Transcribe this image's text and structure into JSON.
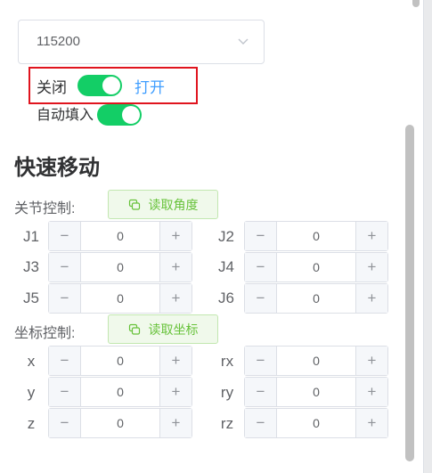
{
  "baud_select": {
    "value": "115200"
  },
  "connection": {
    "close_label": "关闭",
    "open_label": "打开",
    "switch_on": true
  },
  "autofill": {
    "label": "自动填入",
    "switch_on": true
  },
  "quick_move": {
    "title": "快速移动",
    "joint_group": {
      "label": "关节控制:",
      "read_button": "读取角度",
      "fields": [
        {
          "name": "J1",
          "value": "0"
        },
        {
          "name": "J2",
          "value": "0"
        },
        {
          "name": "J3",
          "value": "0"
        },
        {
          "name": "J4",
          "value": "0"
        },
        {
          "name": "J5",
          "value": "0"
        },
        {
          "name": "J6",
          "value": "0"
        }
      ]
    },
    "coord_group": {
      "label": "坐标控制:",
      "read_button": "读取坐标",
      "fields": [
        {
          "name": "x",
          "value": "0"
        },
        {
          "name": "rx",
          "value": "0"
        },
        {
          "name": "y",
          "value": "0"
        },
        {
          "name": "ry",
          "value": "0"
        },
        {
          "name": "z",
          "value": "0"
        },
        {
          "name": "rz",
          "value": "0"
        }
      ]
    },
    "minus_symbol": "−",
    "plus_symbol": "+"
  },
  "colors": {
    "switch_on": "#13ce66",
    "open_link": "#409eff",
    "read_button_text": "#67c23a",
    "highlight_border": "#e0141e"
  }
}
